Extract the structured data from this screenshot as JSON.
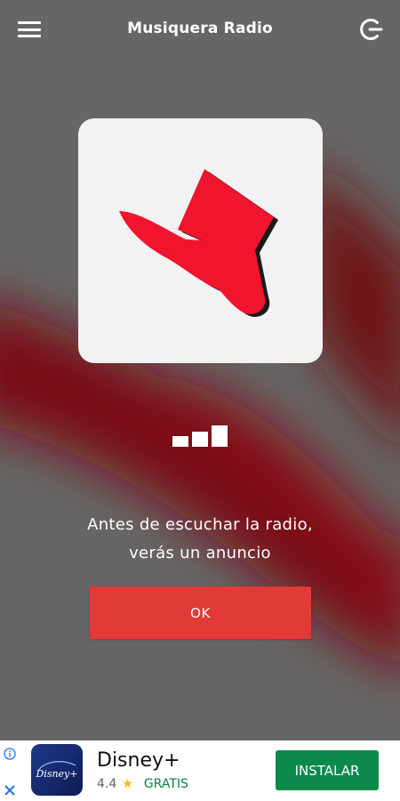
{
  "header": {
    "title": "Musiquera Radio",
    "menu_icon": "hamburger-menu-icon",
    "exit_icon": "power-exit-icon"
  },
  "station": {
    "logo_icon": "musiquera-logo-icon",
    "loading_icon": "signal-bars-icon"
  },
  "notice": {
    "line1": "Antes de escuchar la radio,",
    "line2": "verás un anuncio"
  },
  "ok_button": {
    "label": "OK"
  },
  "ad": {
    "app_name": "Disney+",
    "rating": "4.4",
    "star_icon": "star-icon",
    "price": "GRATIS",
    "install_label": "INSTALAR",
    "icon_text": "Disney+",
    "info_icon": "info-icon",
    "close_icon": "close-icon"
  },
  "colors": {
    "background": "#666666",
    "accent_red": "#e23a36",
    "logo_red": "#f0142d",
    "install_green": "#0b8a4b",
    "price_green": "#0b8043"
  }
}
